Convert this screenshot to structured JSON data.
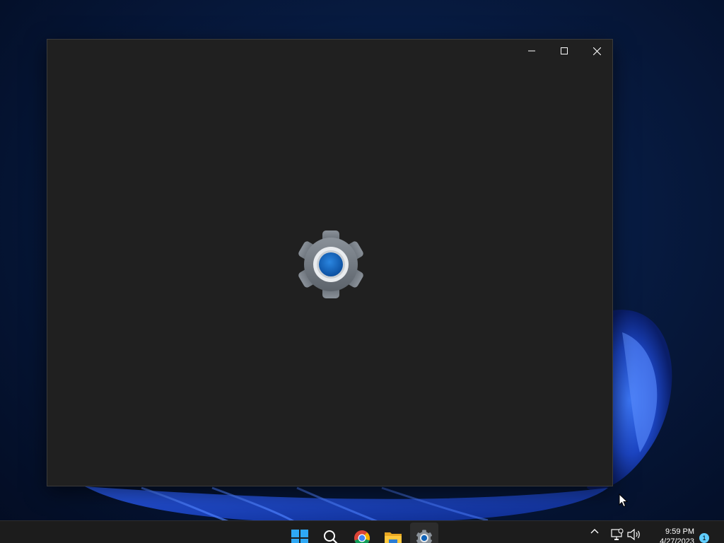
{
  "window": {
    "title": "",
    "controls": {
      "minimize_icon": "minimize-icon",
      "maximize_icon": "maximize-icon",
      "close_icon": "close-icon"
    },
    "splash_icon": "settings-gear-icon",
    "background_color": "#202020"
  },
  "taskbar": {
    "apps": [
      {
        "name": "Start",
        "icon": "windows-start-icon",
        "active": false
      },
      {
        "name": "Search",
        "icon": "search-icon",
        "active": false
      },
      {
        "name": "Google Chrome",
        "icon": "chrome-icon",
        "active": false
      },
      {
        "name": "File Explorer",
        "icon": "file-explorer-icon",
        "active": false
      },
      {
        "name": "Settings",
        "icon": "settings-gear-icon",
        "active": true
      }
    ],
    "tray": {
      "overflow_icon": "chevron-up-icon",
      "network_icon": "network-icon",
      "volume_icon": "volume-icon"
    },
    "clock": {
      "time": "9:59 PM",
      "date": "4/27/2023"
    },
    "notification_count": "1",
    "background_color": "#1c1c1c"
  },
  "colors": {
    "accent": "#0f62b8",
    "notification_badge": "#60cdff",
    "wallpaper_blue": "#1e4fd8"
  }
}
